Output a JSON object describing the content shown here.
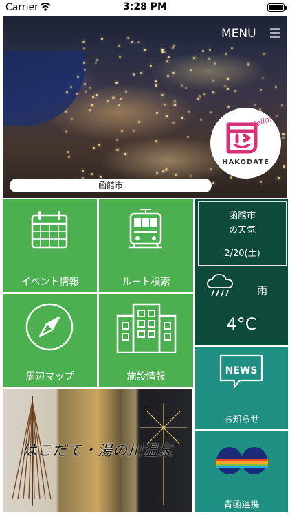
{
  "status_bar": {
    "carrier": "Carrier",
    "time": "3:28 PM"
  },
  "hero": {
    "menu_label": "MENU",
    "city_name": "函館市",
    "logo": {
      "hello": "Hello!",
      "name": "HAKODATE"
    }
  },
  "tiles": {
    "events": {
      "label": "イベント情報",
      "icon": "calendar-icon"
    },
    "route": {
      "label": "ルート検索",
      "icon": "tram-icon"
    },
    "map": {
      "label": "周辺マップ",
      "icon": "compass-icon"
    },
    "facilities": {
      "label": "施設情報",
      "icon": "building-icon"
    }
  },
  "weather": {
    "city": "函館市",
    "title": "の天気",
    "date": "2/20(土)",
    "condition": "雨",
    "icon": "rain-cloud-icon",
    "temperature": "4°C"
  },
  "news": {
    "badge": "NEWS",
    "label": "お知らせ"
  },
  "seikan": {
    "label": "青函連携"
  },
  "onsen": {
    "title": "はこだて・湯の川温泉"
  },
  "colors": {
    "green": "#4caf50",
    "weather_bg": "#0d4a39",
    "teal": "#1e8f80"
  }
}
